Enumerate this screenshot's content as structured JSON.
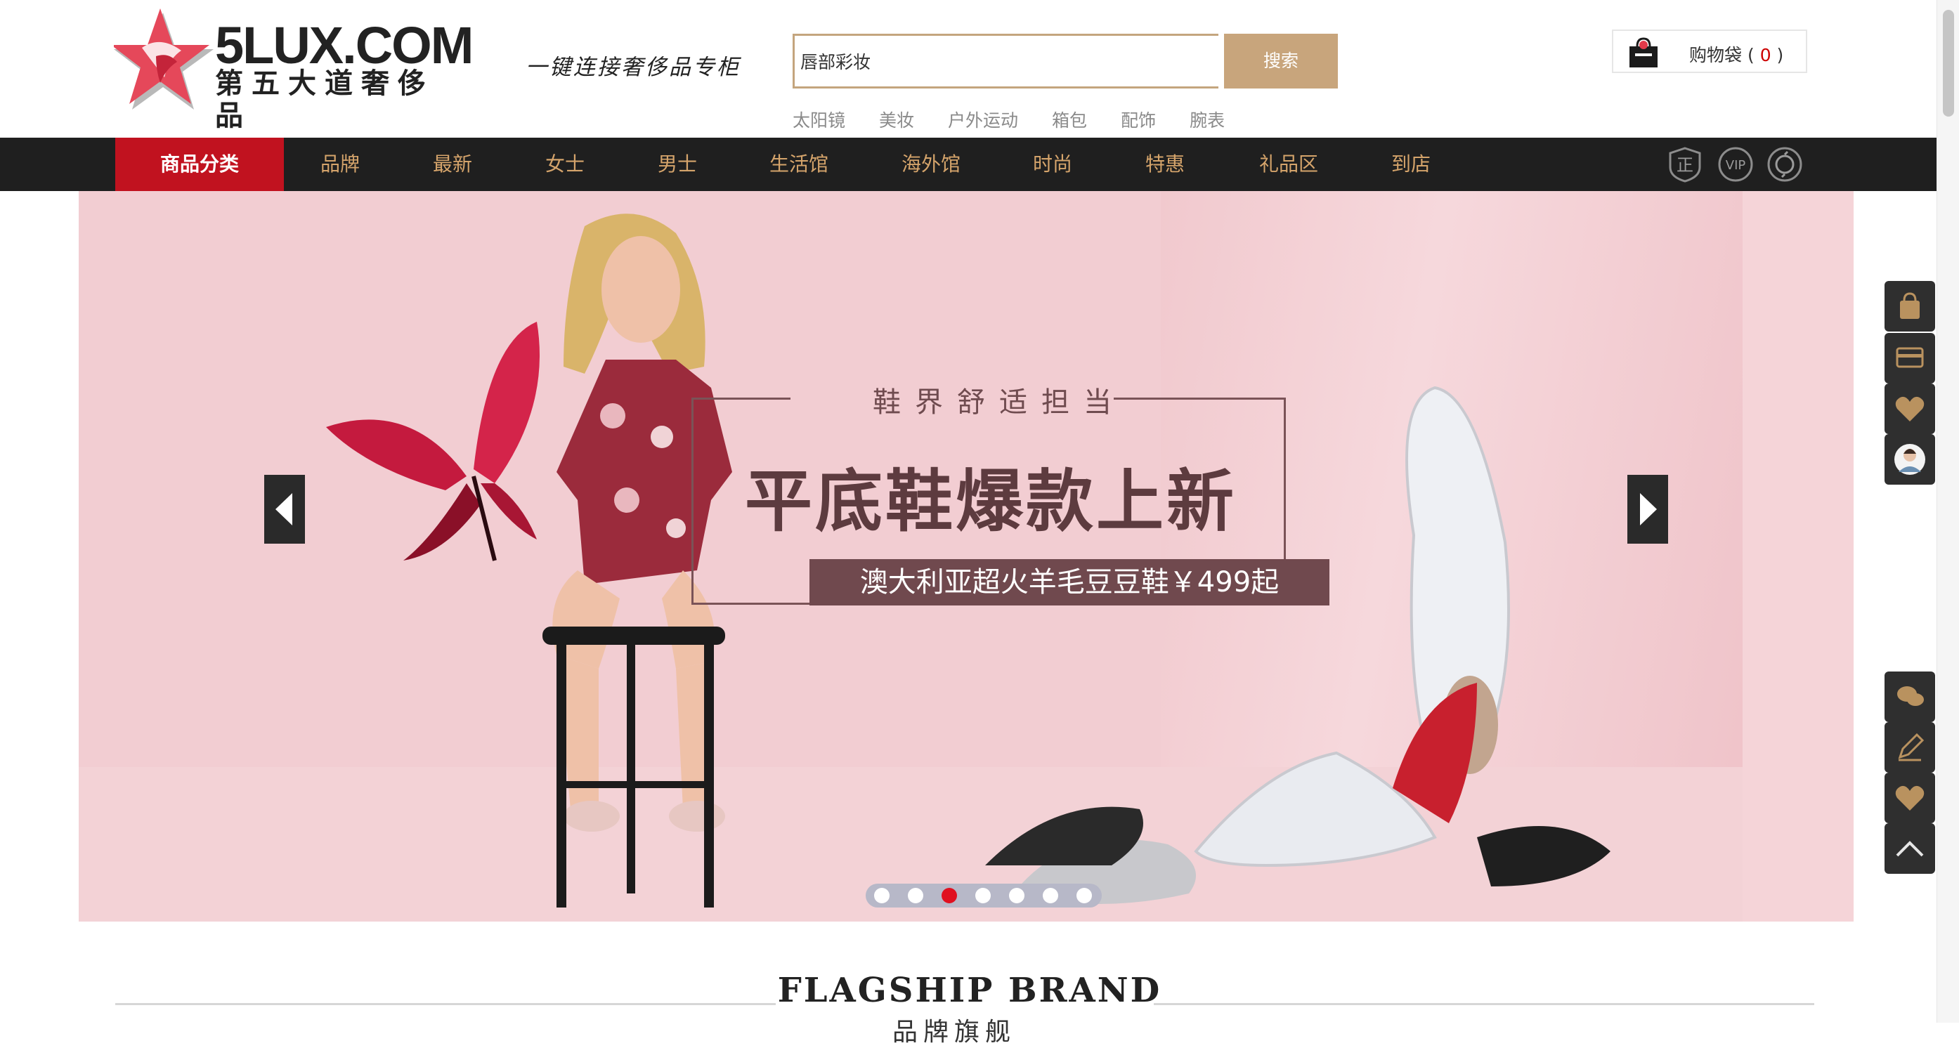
{
  "header": {
    "logo_text": "5LUX.COM",
    "logo_subtitle": "第五大道奢侈品",
    "slogan": "一键连接奢侈品专柜",
    "search": {
      "value": "唇部彩妆",
      "button_label": "搜索"
    },
    "hot_words": [
      "太阳镜",
      "美妆",
      "户外运动",
      "箱包",
      "配饰",
      "腕表"
    ],
    "cart": {
      "label": "购物袋",
      "open": "(",
      "count": "0",
      "close": ")"
    }
  },
  "nav": {
    "items": [
      {
        "label": "商品分类",
        "active": true
      },
      {
        "label": "品牌"
      },
      {
        "label": "最新"
      },
      {
        "label": "女士"
      },
      {
        "label": "男士"
      },
      {
        "label": "生活馆"
      },
      {
        "label": "海外馆"
      },
      {
        "label": "时尚"
      },
      {
        "label": "特惠"
      },
      {
        "label": "礼品区"
      },
      {
        "label": "到店"
      }
    ],
    "badges": [
      "正",
      "VIP",
      "refresh-badge-icon"
    ]
  },
  "banner": {
    "subtitle": "鞋界舒适担当",
    "title": "平底鞋爆款上新",
    "tag": "澳大利亚超火羊毛豆豆鞋￥499起",
    "slide_count": 7,
    "active_slide": 3
  },
  "side_toolbar": {
    "top": [
      "bag-icon",
      "card-icon",
      "heart-icon",
      "avatar"
    ],
    "bottom": [
      "chat-icon",
      "edit-icon",
      "heart-icon",
      "back-to-top-icon"
    ]
  },
  "section": {
    "title": "FLAGSHIP BRAND",
    "subtitle": "品牌旗舰"
  },
  "colors": {
    "accent_gold": "#c8a57c",
    "nav_bg": "#1f1f1f",
    "nav_active": "#c1121f",
    "banner_bg": "#f2cdd2"
  }
}
